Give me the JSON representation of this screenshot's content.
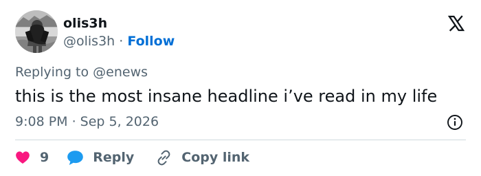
{
  "user": {
    "display_name": "olis3h",
    "handle": "@olis3h",
    "separator": "·",
    "follow_label": "Follow"
  },
  "replying": {
    "prefix": "Replying to",
    "handle": "@enews"
  },
  "tweet": {
    "text": "this is the most insane headline i’ve read in my life",
    "timestamp": "9:08 PM · Sep 5, 2026"
  },
  "actions": {
    "like_count": "9",
    "reply_label": "Reply",
    "copy_link_label": "Copy link"
  },
  "icons": {
    "brand": "x-logo-icon",
    "info": "info-icon",
    "like": "heart-icon",
    "reply": "speech-bubble-icon",
    "copy": "link-icon"
  },
  "colors": {
    "text_primary": "#0f1419",
    "text_secondary": "#536471",
    "link": "#006fd6",
    "like": "#f91880",
    "reply": "#1d9bf0",
    "divider": "#cfd9de"
  }
}
